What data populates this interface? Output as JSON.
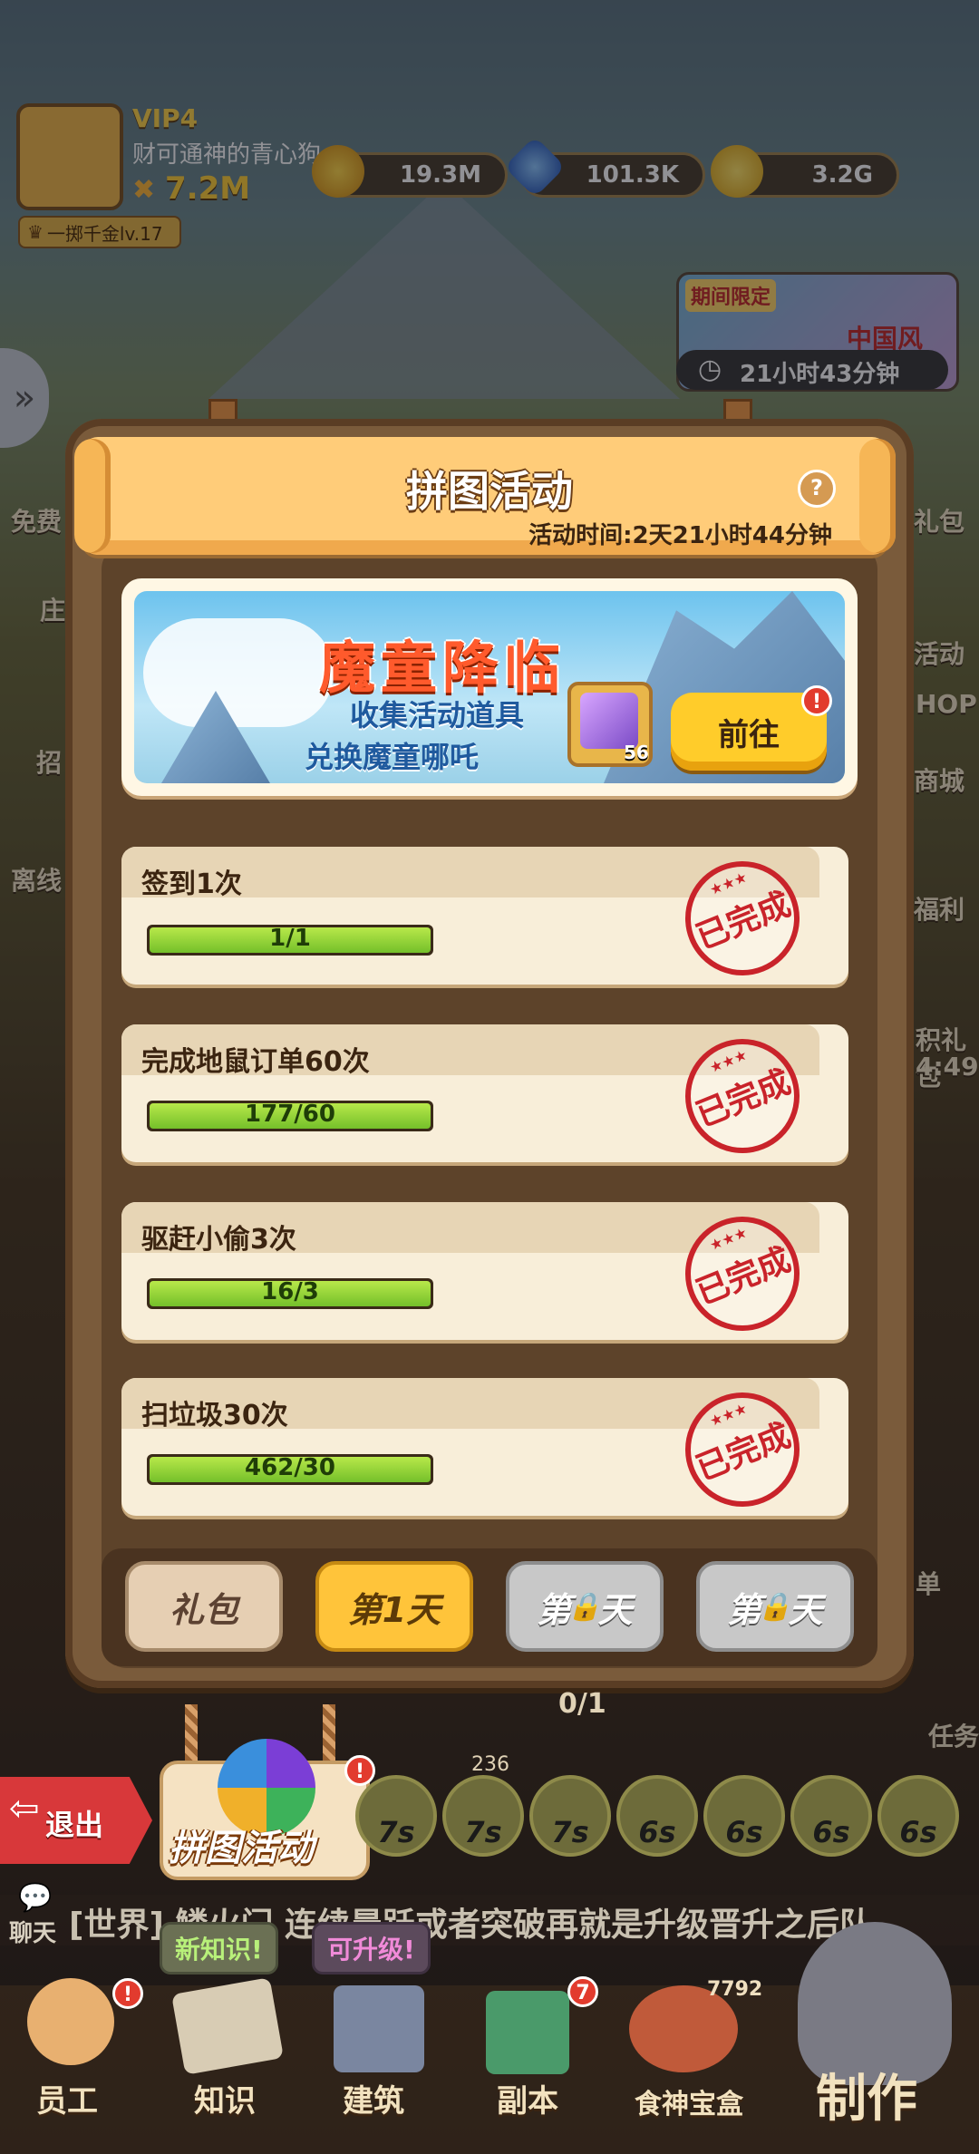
{
  "hud": {
    "vip": "VIP4",
    "nickname": "财可通神的青心狗",
    "power": "7.2M",
    "rank": "一掷千金lv.17",
    "trophy": "19.3M",
    "gems": "101.3K",
    "coins": "3.2G"
  },
  "limited_event": {
    "label": "期间限定",
    "title": "中国风",
    "timer": "21小时43分钟"
  },
  "side_left": [
    "免费",
    "庄",
    "招",
    "离线"
  ],
  "side_right": [
    "礼包",
    "活动",
    "HOP",
    "商城",
    "福利",
    "积礼包",
    "4:49",
    "单",
    "任务"
  ],
  "panel": {
    "title": "拼图活动",
    "help": "?",
    "time": "活动时间:2天21小时44分钟"
  },
  "promo": {
    "title": "魔童降临",
    "sub1": "收集活动道具",
    "sub2": "兑换魔童哪吒",
    "item_count": "56",
    "go_button": "前往",
    "badge": "!"
  },
  "tasks": [
    {
      "name": "签到1次",
      "done": "1",
      "sep": "/",
      "goal": "1",
      "progress": 1.0,
      "stamp": "已完成"
    },
    {
      "name": "完成地鼠订单60次",
      "done": "177",
      "sep": "/",
      "goal": "60",
      "progress": 1.0,
      "stamp": "已完成"
    },
    {
      "name": "驱赶小偷3次",
      "done": "16",
      "sep": "/",
      "goal": "3",
      "progress": 1.0,
      "stamp": "已完成"
    },
    {
      "name": "扫垃圾30次",
      "done": "462",
      "sep": "/",
      "goal": "30",
      "progress": 1.0,
      "stamp": "已完成"
    }
  ],
  "tabs": {
    "gift": "礼包",
    "day1": "第1天",
    "day2_pre": "第",
    "day2_post": "天",
    "day3_pre": "第",
    "day3_post": "天"
  },
  "bottom": {
    "exit": "退出",
    "puzzle": "拼图活动",
    "puzzle_badge": "!",
    "timers": [
      "7s",
      "7s",
      "7s",
      "6s",
      "6s",
      "6s",
      "6s"
    ],
    "chat_label": "聊天",
    "chat_text": "[世界] 鳞火门 连续晨跃或者突破再就是升级晋升之后队",
    "tag_knowledge": "新知识!",
    "tag_upgrade": "可升级!",
    "nav": [
      "员工",
      "知识",
      "建筑",
      "副本",
      "食神宝盒",
      "制作"
    ],
    "dungeon_badge": "7",
    "chest_count": "7792",
    "counter": "0/1",
    "counter2": "236"
  }
}
